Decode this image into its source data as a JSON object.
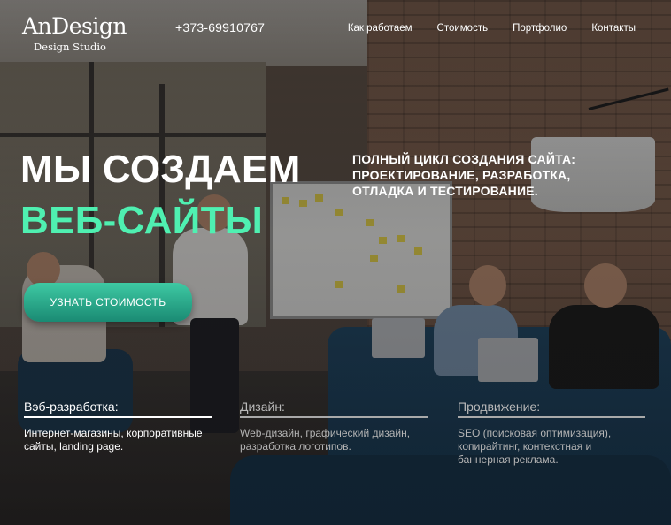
{
  "header": {
    "logo_name": "AnDesign",
    "logo_tagline": "Design Studio",
    "phone": "+373-69910767",
    "nav": [
      {
        "label": "Как работаем"
      },
      {
        "label": "Стоимость"
      },
      {
        "label": "Портфолио"
      },
      {
        "label": "Контакты"
      }
    ]
  },
  "hero": {
    "title_line1": "МЫ СОЗДАЕМ",
    "title_line2": "ВЕБ-САЙТЫ",
    "subtitle": "ПОЛНЫЙ ЦИКЛ СОЗДАНИЯ САЙТА: ПРОЕКТИРОВАНИЕ, РАЗРАБОТКА, ОТЛАДКА И ТЕСТИРОВАНИЕ.",
    "cta_label": "УЗНАТЬ СТОИМОСТЬ"
  },
  "services": [
    {
      "title": "Вэб-разработка:",
      "description": "Интернет-магазины, корпоративные сайты, landing page.",
      "active": true
    },
    {
      "title": "Дизайн:",
      "description": "Web-дизайн, графический дизайн, разработка логотипов.",
      "active": false
    },
    {
      "title": "Продвижение:",
      "description": "SEO (поисковая оптимизация), копирайтинг, контекстная и баннерная реклама.",
      "active": false
    }
  ],
  "colors": {
    "accent": "#4ff0b1",
    "button_top": "#3ec9a3",
    "button_bottom": "#1a8a73",
    "inactive_text": "#b9b9b9"
  }
}
